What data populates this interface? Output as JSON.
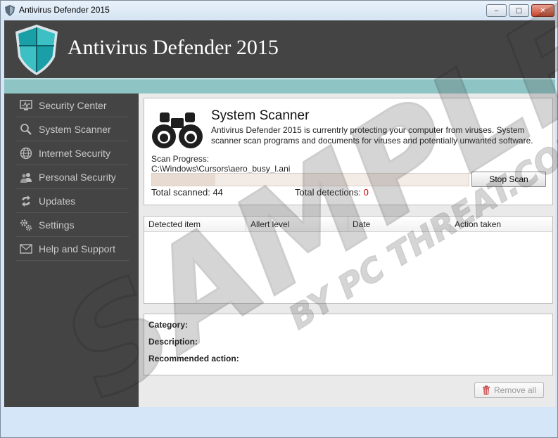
{
  "window": {
    "title": "Antivirus Defender 2015",
    "controls": {
      "minimize": "‒",
      "maximize": "□",
      "close": "✕"
    }
  },
  "header": {
    "app_name": "Antivirus Defender 2015"
  },
  "sidebar": {
    "items": [
      {
        "label": "Security Center",
        "icon": "monitor-icon"
      },
      {
        "label": "System Scanner",
        "icon": "magnifier-icon"
      },
      {
        "label": "Internet Security",
        "icon": "globe-icon"
      },
      {
        "label": "Personal Security",
        "icon": "users-icon"
      },
      {
        "label": "Updates",
        "icon": "refresh-icon"
      },
      {
        "label": "Settings",
        "icon": "gears-icon"
      },
      {
        "label": "Help and Support",
        "icon": "envelope-icon"
      }
    ]
  },
  "scanner": {
    "title": "System Scanner",
    "description": "Antivirus Defender 2015 is currentrly protecting your computer from viruses. System scanner scan programs and documents for viruses and potentially unwanted software.",
    "progress_label": "Scan Progress:",
    "current_file": "C:\\Windows\\Cursors\\aero_busy_l.ani",
    "progress_fraction": 0.2,
    "stop_button": "Stop Scan",
    "total_scanned_label": "Total scanned: 44",
    "total_detections_label": "Total detections:",
    "total_detections_count": "0"
  },
  "detections_table": {
    "columns": [
      "Detected item",
      "Allert level",
      "Date",
      "Action taken"
    ],
    "rows": []
  },
  "details": {
    "category_label": "Category:",
    "description_label": "Description:",
    "recommended_label": "Recommended action:"
  },
  "actions": {
    "remove_all": "Remove all"
  },
  "watermark": {
    "line1": "SAMPLE",
    "line2": "BY PC THREAT.COM"
  },
  "colors": {
    "header_bg": "#444444",
    "teal_band": "#8fc4c4",
    "shield": "#1a9fa6",
    "detection_count": "#cc0000"
  }
}
